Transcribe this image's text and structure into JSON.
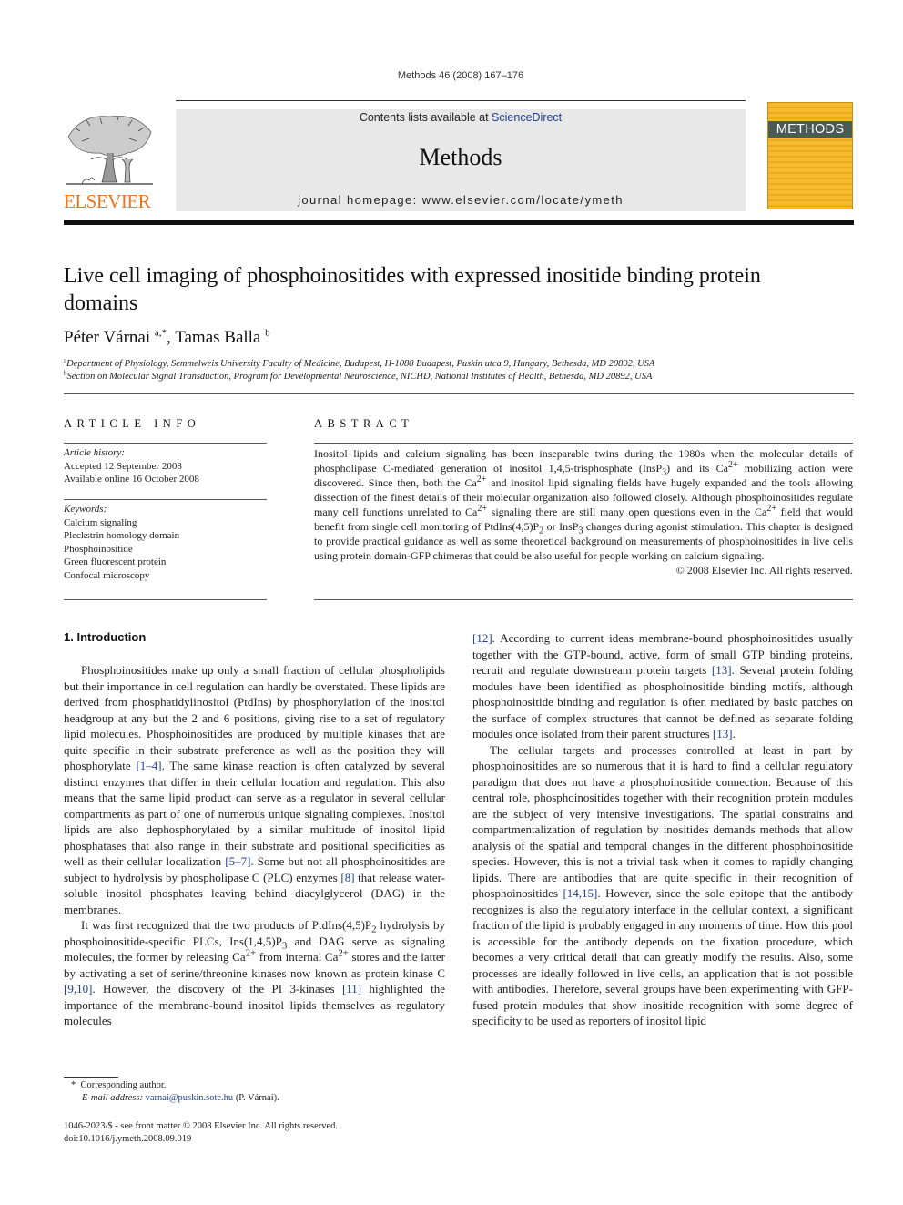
{
  "header": {
    "citation": "Methods 46 (2008) 167–176",
    "contents_prefix": "Contents lists available at ",
    "contents_link": "ScienceDirect",
    "journal_name": "Methods",
    "homepage": "journal homepage: www.elsevier.com/locate/ymeth",
    "publisher_logo_text": "ELSEVIER",
    "cover_title": "METHODS",
    "colors": {
      "elsevier_orange": "#e87722",
      "link_blue": "#1f3f95",
      "cover_yellow": "#f4bb2e",
      "banner_gray": "#e8e8e8"
    }
  },
  "article": {
    "title": "Live cell imaging of phosphoinositides with expressed inositide binding protein domains",
    "authors": [
      {
        "name": "Péter Várnai",
        "marks": "a,*"
      },
      {
        "name": "Tamas Balla",
        "marks": "b"
      }
    ],
    "affiliations": [
      {
        "mark": "a",
        "text": "Department of Physiology, Semmelweis University Faculty of Medicine, Budapest, H-1088 Budapest, Puskin utca 9, Hungary, Bethesda, MD 20892, USA"
      },
      {
        "mark": "b",
        "text": "Section on Molecular Signal Transduction, Program for Developmental Neuroscience, NICHD, National Institutes of Health, Bethesda, MD 20892, USA"
      }
    ]
  },
  "article_info": {
    "heading": "ARTICLE INFO",
    "history_label": "Article history:",
    "history": [
      "Accepted 12 September 2008",
      "Available online 16 October 2008"
    ],
    "keywords_label": "Keywords:",
    "keywords": [
      "Calcium signaling",
      "Pleckstrin homology domain",
      "Phosphoinositide",
      "Green fluorescent protein",
      "Confocal microscopy"
    ]
  },
  "abstract": {
    "heading": "ABSTRACT",
    "s1": "Inositol lipids and calcium signaling has been inseparable twins during the 1980s when the molecular details of phospholipase C-mediated generation of inositol 1,4,5-trisphosphate (InsP",
    "s2": ") and its Ca",
    "s3": " mobilizing action were discovered. Since then, both the Ca",
    "s4": " and inositol lipid signaling fields have hugely expanded and the tools allowing dissection of the finest details of their molecular organization also followed closely. Although phosphoinositides regulate many cell functions unrelated to Ca",
    "s5": " signaling there are still many open questions even in the Ca",
    "s6": " field that would benefit from single cell monitoring of PtdIns(4,5)P",
    "s7": " or InsP",
    "s8": " changes during agonist stimulation. This chapter is designed to provide practical guidance as well as some theoretical background on measurements of phosphoinositides in live cells using protein domain-GFP chimeras that could be also useful for people working on calcium signaling.",
    "copyright": "© 2008 Elsevier Inc. All rights reserved.",
    "sub3": "3",
    "sub2": "2",
    "sup2plus": "2+"
  },
  "intro": {
    "heading": "1. Introduction",
    "p1a": "Phosphoinositides make up only a small fraction of cellular phospholipids but their importance in cell regulation can hardly be overstated. These lipids are derived from phosphatidylinositol (PtdIns) by phosphorylation of the inositol headgroup at any but the 2 and 6 positions, giving rise to a set of regulatory lipid molecules. Phosphoinositides are produced by multiple kinases that are quite specific in their substrate preference as well as the position they will phosphorylate ",
    "ref1": "[1–4]",
    "p1b": ". The same kinase reaction is often catalyzed by several distinct enzymes that differ in their cellular location and regulation. This also means that the same lipid product can serve as a regulator in several cellular compartments as part of one of numerous unique signaling complexes. Inositol lipids are also dephosphorylated by a similar multitude of inositol lipid phosphatases that also range in their substrate and positional specificities as well as their cellular localization ",
    "ref2": "[5–7]",
    "p1c": ". Some but not all phosphoinositides are subject to hydrolysis by phospholipase C (PLC) enzymes ",
    "ref3": "[8]",
    "p1d": " that release water-soluble inositol phosphates leaving behind diacylglycerol (DAG) in the membranes.",
    "p2a": "It was first recognized that the two products of PtdIns(4,5)P",
    "p2b": " hydrolysis by phosphoinositide-specific PLCs, Ins(1,4,5)P",
    "p2c": " and DAG serve as signaling molecules, the former by releasing Ca",
    "p2d": " from internal Ca",
    "p2e": " stores and the latter by activating a set of serine/threonine kinases now known as protein kinase C ",
    "ref4": "[9,10]",
    "p2f": ". However, the discovery of the PI 3-kinases ",
    "ref5": "[11]",
    "p2g": " highlighted the importance of the membrane-bound inositol lipids themselves as regulatory molecules ",
    "ref6": "[12]",
    "p2h": ". According to current ideas membrane-bound phosphoinositides usually together with the GTP-bound, active, form of small GTP binding proteins, recruit and regulate downstream protein targets ",
    "ref7": "[13]",
    "p2i": ". Several protein folding modules have been identified as phosphoinositide binding motifs, although phosphoinositide binding and regulation is often mediated by basic patches on the surface of complex structures that cannot be defined as separate folding modules once isolated from their parent structures ",
    "ref8": "[13]",
    "p2j": ".",
    "p3a": "The cellular targets and processes controlled at least in part by phosphoinositides are so numerous that it is hard to find a cellular regulatory paradigm that does not have a phosphoinositide connection. Because of this central role, phosphoinositides together with their recognition protein modules are the subject of very intensive investigations. The spatial constrains and compartmentalization of regulation by inositides demands methods that allow analysis of the spatial and temporal changes in the different phosphoinositide species. However, this is not a trivial task when it comes to rapidly changing lipids. There are antibodies that are quite specific in their recognition of phosphoinositides ",
    "ref9": "[14,15]",
    "p3b": ". However, since the sole epitope that the antibody recognizes is also the regulatory interface in the cellular context, a significant fraction of the lipid is probably engaged in any moments of time. How this pool is accessible for the antibody depends on the fixation procedure, which becomes a very critical detail that can greatly modify the results. Also, some processes are ideally followed in live cells, an application that is not possible with antibodies. Therefore, several groups have been experimenting with GFP-fused protein modules that show inositide recognition with some degree of specificity to be used as reporters of inositol lipid"
  },
  "footnotes": {
    "star": "*",
    "corresponding": "Corresponding author.",
    "email_label": "E-mail address:",
    "email": "varnai@puskin.sote.hu",
    "email_suffix": " (P. Várnai).",
    "issn": "1046-2023/$ - see front matter © 2008 Elsevier Inc. All rights reserved.",
    "doi": "doi:10.1016/j.ymeth.2008.09.019"
  }
}
